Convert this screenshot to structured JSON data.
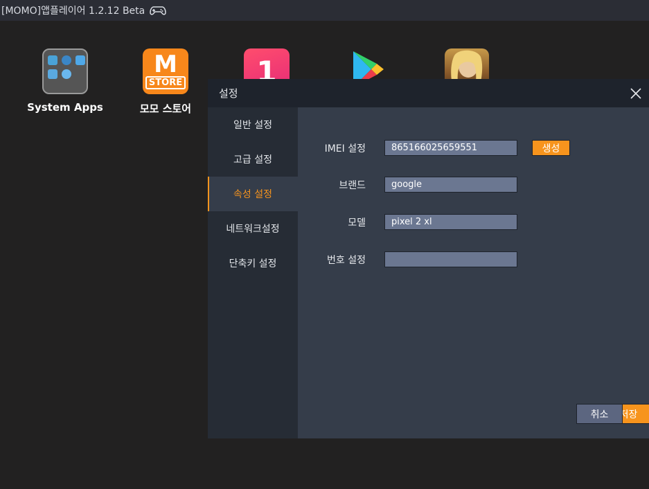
{
  "window": {
    "title": "[MOMO]앱플레이어 1.2.12 Beta",
    "gamepad_icon": "gamepad-icon"
  },
  "desktop": {
    "apps": [
      {
        "label": "System Apps",
        "icon": "system-apps-icon"
      },
      {
        "label": "모모 스토어",
        "icon": "momo-store-icon",
        "logo_text": "M",
        "badge": "STORE"
      },
      {
        "label": "",
        "icon": "one-store-icon",
        "logo_text": "1"
      },
      {
        "label": "",
        "icon": "google-play-icon"
      },
      {
        "label": "",
        "icon": "game-app-icon"
      }
    ]
  },
  "dialog": {
    "title": "설정",
    "close_icon": "close-icon",
    "nav": [
      {
        "label": "일반 설정",
        "active": false
      },
      {
        "label": "고급 설정",
        "active": false
      },
      {
        "label": "속성 설정",
        "active": true
      },
      {
        "label": "네트워크설정",
        "active": false
      },
      {
        "label": "단축키 설정",
        "active": false
      }
    ],
    "fields": {
      "imei": {
        "label": "IMEI 설정",
        "value": "865166025659551"
      },
      "brand": {
        "label": "브랜드",
        "value": "google"
      },
      "model": {
        "label": "모델",
        "value": "pixel 2 xl"
      },
      "number": {
        "label": "번호 설정",
        "value": ""
      }
    },
    "generate_label": "생성",
    "save_label": "저장",
    "cancel_label": "취소"
  },
  "colors": {
    "accent": "#f7941d",
    "dialog_bg": "#353d4a",
    "sidebar_bg": "#262c35",
    "header_bg": "#1e232c",
    "field_bg": "#6b7791",
    "desktop_bg": "#222121"
  }
}
